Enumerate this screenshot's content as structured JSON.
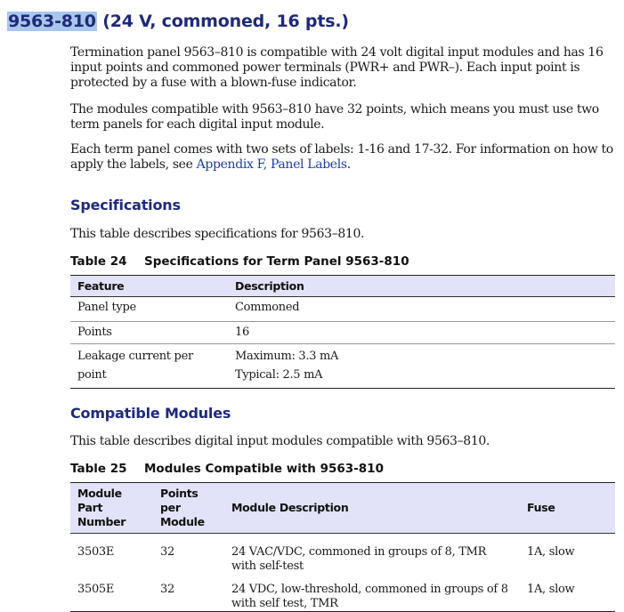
{
  "heading": {
    "part": "9563-810",
    "rest": " (24 V, commoned, 16 pts.)"
  },
  "intro": {
    "p1": "Termination panel 9563–810 is compatible with 24 volt digital input modules and has 16 input points and commoned power terminals (PWR+ and PWR–). Each input point is protected by a fuse with a blown-fuse indicator.",
    "p2": "The modules compatible with 9563–810 have 32 points, which means you must use two term panels for each digital input module.",
    "p3_start": "Each term panel comes with two sets of labels: 1-16 and 17-32. For information on how to apply the labels, see ",
    "p3_link": "Appendix F, Panel Labels",
    "p3_end": "."
  },
  "specifications": {
    "title": "Specifications",
    "description": "This table describes specifications for 9563–810.",
    "table_number": "Table 24",
    "table_title": "Specifications for Term Panel 9563-810",
    "headers": [
      "Feature",
      "Description"
    ],
    "rows": [
      {
        "feature": "Panel type",
        "description": [
          "Commoned"
        ]
      },
      {
        "feature": "Points",
        "description": [
          "16"
        ]
      },
      {
        "feature": "Leakage current per point",
        "description": [
          "Maximum: 3.3 mA",
          "Typical: 2.5 mA"
        ]
      }
    ]
  },
  "compatible": {
    "title": "Compatible Modules",
    "description": "This table describes digital input modules compatible with 9563–810.",
    "table_number": "Table 25",
    "table_title": "Modules Compatible with 9563-810",
    "headers": [
      "Module Part Number",
      "Points per Module",
      "Module Description",
      "Fuse"
    ],
    "rows": [
      {
        "part": "3503E",
        "points": "32",
        "description": "24 VAC/VDC, commoned in groups of 8, TMR with self-test",
        "fuse": "1A, slow"
      },
      {
        "part": "3505E",
        "points": "32",
        "description": "24 VDC, low-threshold, commoned in groups of 8 with self test, TMR",
        "fuse": "1A, slow"
      }
    ]
  },
  "colors": {
    "heading": "#1f2a78",
    "selection": "#a9c6ec",
    "table_header_bg": "#e2e2f8",
    "link": "#1f3ea0"
  }
}
